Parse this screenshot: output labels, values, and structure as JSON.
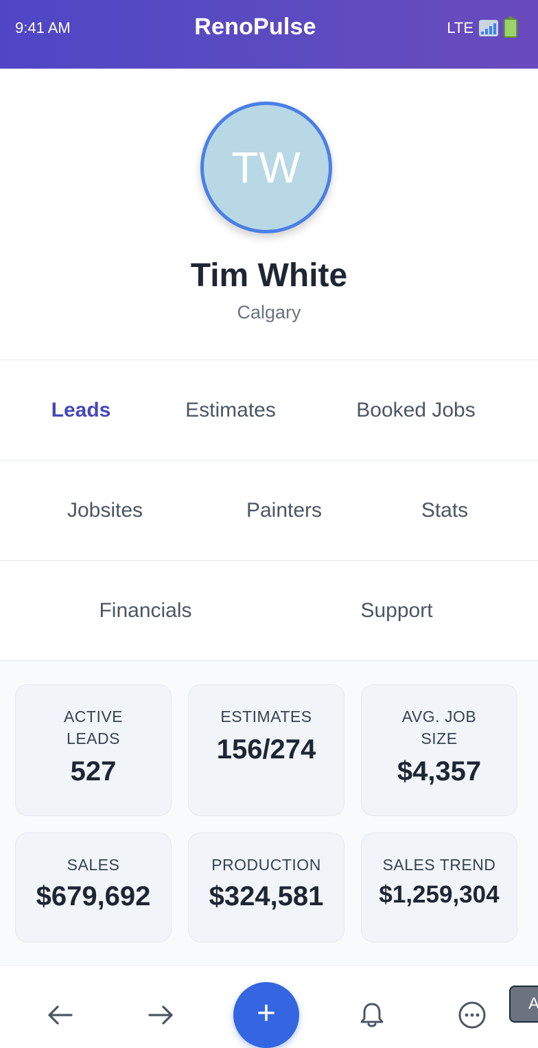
{
  "status_bar": {
    "time": "9:41 AM",
    "network": "LTE"
  },
  "app": {
    "title": "RenoPulse"
  },
  "profile": {
    "initials": "TW",
    "name": "Tim White",
    "city": "Calgary"
  },
  "nav": {
    "row1": [
      {
        "label": "Leads",
        "active": true
      },
      {
        "label": "Estimates",
        "active": false
      },
      {
        "label": "Booked Jobs",
        "active": false
      }
    ],
    "row2": [
      {
        "label": "Jobsites"
      },
      {
        "label": "Painters"
      },
      {
        "label": "Stats"
      }
    ],
    "row3": [
      {
        "label": "Financials"
      },
      {
        "label": "Support"
      }
    ]
  },
  "stats": [
    {
      "label": "ACTIVE LEADS",
      "value": "527"
    },
    {
      "label": "ESTIMATES",
      "value": "156/274"
    },
    {
      "label": "AVG. JOB SIZE",
      "value": "$4,357"
    },
    {
      "label": "SALES",
      "value": "$679,692"
    },
    {
      "label": "PRODUCTION",
      "value": "$324,581"
    },
    {
      "label": "SALES TREND",
      "value": "$1,259,304"
    }
  ],
  "bottom_bar": {
    "back_icon": "arrow-left-icon",
    "forward_icon": "arrow-right-icon",
    "fab_label": "+",
    "notifications_icon": "bell-icon",
    "more_icon": "ellipsis-icon"
  },
  "floating_chip": {
    "label": "A"
  },
  "colors": {
    "accent": "#4747b8",
    "fab": "#3366e0",
    "avatar_ring": "#4a7fe6"
  }
}
